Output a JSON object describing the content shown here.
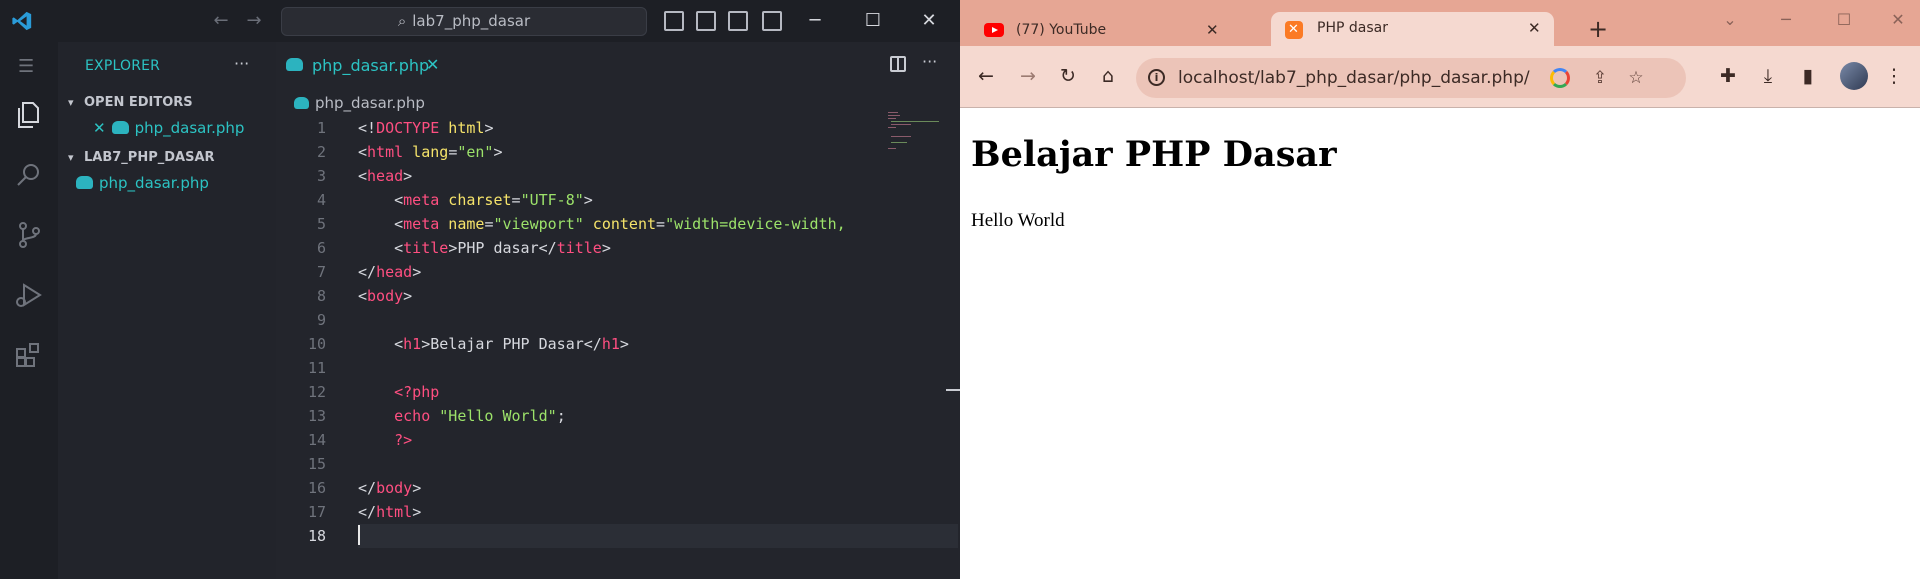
{
  "vscode": {
    "search_text": "lab7_php_dasar",
    "explorer_title": "EXPLORER",
    "more": "···",
    "open_editors_label": "OPEN EDITORS",
    "open_editor_file": "php_dasar.php",
    "project_label": "LAB7_PHP_DASAR",
    "project_file": "php_dasar.php",
    "tab_label": "php_dasar.php",
    "breadcrumb": "php_dasar.php",
    "code_lines": [
      {
        "n": "1"
      },
      {
        "n": "2"
      },
      {
        "n": "3"
      },
      {
        "n": "4"
      },
      {
        "n": "5"
      },
      {
        "n": "6"
      },
      {
        "n": "7"
      },
      {
        "n": "8"
      },
      {
        "n": "9"
      },
      {
        "n": "10"
      },
      {
        "n": "11"
      },
      {
        "n": "12"
      },
      {
        "n": "13"
      },
      {
        "n": "14"
      },
      {
        "n": "15"
      },
      {
        "n": "16"
      },
      {
        "n": "17"
      },
      {
        "n": "18"
      }
    ],
    "code": {
      "l1a": "<!",
      "l1b": "DOCTYPE",
      "l1c": " html",
      "l1d": ">",
      "l2a": "<",
      "l2b": "html",
      "l2c": " lang",
      "l2d": "=",
      "l2e": "\"en\"",
      "l2f": ">",
      "l3a": "<",
      "l3b": "head",
      "l3c": ">",
      "l4a": "    <",
      "l4b": "meta",
      "l4c": " charset",
      "l4d": "=",
      "l4e": "\"UTF-8\"",
      "l4f": ">",
      "l5a": "    <",
      "l5b": "meta",
      "l5c": " name",
      "l5d": "=",
      "l5e": "\"viewport\"",
      "l5f": " content",
      "l5g": "=",
      "l5h": "\"width=device-width,",
      "l6a": "    <",
      "l6b": "title",
      "l6c": ">PHP dasar</",
      "l6d": "title",
      "l6e": ">",
      "l7a": "</",
      "l7b": "head",
      "l7c": ">",
      "l8a": "<",
      "l8b": "body",
      "l8c": ">",
      "l10a": "    <",
      "l10b": "h1",
      "l10c": ">Belajar PHP Dasar</",
      "l10d": "h1",
      "l10e": ">",
      "l12a": "    <?php",
      "l13a": "    echo ",
      "l13b": "\"Hello World\"",
      "l13c": ";",
      "l14a": "    ?>",
      "l16a": "</",
      "l16b": "body",
      "l16c": ">",
      "l17a": "</",
      "l17b": "html",
      "l17c": ">"
    },
    "colors": {
      "accent": "#2cc3c3",
      "tag": "#ff4f81",
      "attr": "#f5e36a",
      "string": "#9ce26a"
    }
  },
  "chrome": {
    "tab1_label": "(77) YouTube",
    "tab2_label": "PHP dasar",
    "url": "localhost/lab7_php_dasar/php_dasar.php/",
    "page_heading": "Belajar PHP Dasar",
    "page_text": "Hello World",
    "colors": {
      "tabstrip": "#e6a694",
      "toolbar": "#f5d9d0"
    }
  },
  "icons": [
    "vscode-logo-icon",
    "explorer-icon",
    "search-icon",
    "source-control-icon",
    "run-debug-icon",
    "extensions-icon",
    "back-icon",
    "forward-icon",
    "reload-icon",
    "home-icon",
    "star-icon",
    "share-icon",
    "google-icon",
    "extensions-puzzle-icon",
    "download-icon",
    "sidepanel-icon",
    "menu-icon"
  ]
}
